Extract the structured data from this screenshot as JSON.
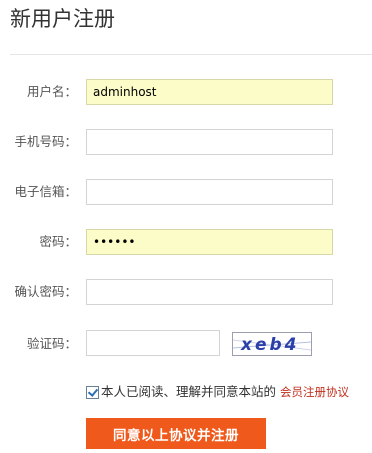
{
  "page": {
    "title": "新用户注册"
  },
  "form": {
    "username": {
      "label": "用户名：",
      "value": "adminhost"
    },
    "phone": {
      "label": "手机号码：",
      "value": ""
    },
    "email": {
      "label": "电子信箱：",
      "value": ""
    },
    "password": {
      "label": "密码：",
      "value": "......"
    },
    "confirm_password": {
      "label": "确认密码：",
      "value": ""
    },
    "captcha": {
      "label": "验证码：",
      "value": "",
      "image_text": "xeb4"
    },
    "agree": {
      "checked": true,
      "text": "本人已阅读、理解并同意本站的",
      "link_text": "会员注册协议"
    },
    "submit_label": "同意以上协议并注册"
  },
  "colors": {
    "filled_field_bg": "#fbfcc8",
    "submit_bg": "#ef5a1c",
    "link": "#c0301e",
    "captcha_ink": "#2b3fa8"
  }
}
